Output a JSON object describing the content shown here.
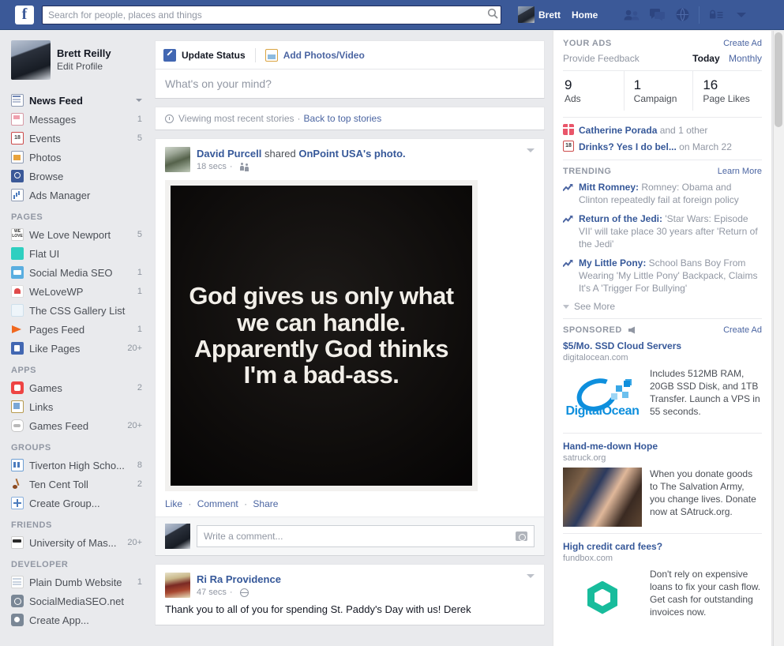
{
  "header": {
    "logo": "f",
    "search_placeholder": "Search for people, places and things",
    "search_value": "",
    "search_icon": "search-icon",
    "profile_name": "Brett",
    "home_label": "Home",
    "icons": [
      "friend-requests-icon",
      "messages-icon",
      "notifications-icon",
      "privacy-shortcuts-icon",
      "account-menu-caret-icon"
    ]
  },
  "sidebar": {
    "profile": {
      "name": "Brett Reilly",
      "sub": "Edit Profile"
    },
    "main_items": [
      {
        "label": "News Feed",
        "count": "",
        "icon": "newsfeed-icon",
        "current": true,
        "caret": true
      },
      {
        "label": "Messages",
        "count": "1",
        "icon": "messages-icon"
      },
      {
        "label": "Events",
        "count": "5",
        "icon": "events-icon"
      },
      {
        "label": "Photos",
        "count": "",
        "icon": "photos-icon"
      },
      {
        "label": "Browse",
        "count": "",
        "icon": "browse-icon"
      },
      {
        "label": "Ads Manager",
        "count": "",
        "icon": "ads-manager-icon"
      }
    ],
    "sections": [
      {
        "title": "PAGES",
        "items": [
          {
            "label": "We Love Newport",
            "count": "5",
            "icon": "page-we-love-newport-icon"
          },
          {
            "label": "Flat UI",
            "count": "",
            "icon": "page-flat-ui-icon"
          },
          {
            "label": "Social Media SEO",
            "count": "1",
            "icon": "page-social-media-seo-icon"
          },
          {
            "label": "WeLoveWP",
            "count": "1",
            "icon": "page-welovewp-icon"
          },
          {
            "label": "The CSS Gallery List",
            "count": "",
            "icon": "page-css-gallery-icon"
          },
          {
            "label": "Pages Feed",
            "count": "1",
            "icon": "pages-feed-icon"
          },
          {
            "label": "Like Pages",
            "count": "20+",
            "icon": "like-pages-icon"
          }
        ]
      },
      {
        "title": "APPS",
        "items": [
          {
            "label": "Games",
            "count": "2",
            "icon": "games-icon"
          },
          {
            "label": "Links",
            "count": "",
            "icon": "links-icon"
          },
          {
            "label": "Games Feed",
            "count": "20+",
            "icon": "games-feed-icon"
          }
        ]
      },
      {
        "title": "GROUPS",
        "items": [
          {
            "label": "Tiverton High Scho...",
            "count": "8",
            "icon": "group-tiverton-icon"
          },
          {
            "label": "Ten Cent Toll",
            "count": "2",
            "icon": "group-ten-cent-toll-icon"
          },
          {
            "label": "Create Group...",
            "count": "",
            "icon": "create-group-icon"
          }
        ]
      },
      {
        "title": "FRIENDS",
        "items": [
          {
            "label": "University of Mas...",
            "count": "20+",
            "icon": "friends-umass-icon"
          }
        ]
      },
      {
        "title": "DEVELOPER",
        "items": [
          {
            "label": "Plain Dumb Website",
            "count": "1",
            "icon": "dev-plain-dumb-icon"
          },
          {
            "label": "SocialMediaSEO.net",
            "count": "",
            "icon": "dev-socialmediaseo-icon"
          },
          {
            "label": "Create App...",
            "count": "",
            "icon": "create-app-icon"
          }
        ]
      }
    ]
  },
  "composer": {
    "tab_status": "Update Status",
    "tab_photos": "Add Photos/Video",
    "placeholder": "What's on your mind?"
  },
  "stories_bar": {
    "text": "Viewing most recent stories",
    "separator": "·",
    "link": "Back to top stories"
  },
  "posts": [
    {
      "author": "David Purcell",
      "action": "shared",
      "target": "OnPoint USA's photo.",
      "time": "18 secs",
      "audience_icon": "friends-audience-icon",
      "photo_text": "God gives us only what we can handle. Apparently God thinks I'm a bad-ass.",
      "actions": {
        "like": "Like",
        "comment": "Comment",
        "share": "Share",
        "sep": "·"
      },
      "comment_placeholder": "Write a comment...",
      "camera_icon": "camera-icon"
    },
    {
      "author": "Ri Ra Providence",
      "time": "47 secs",
      "audience_icon": "public-globe-icon",
      "body": "Thank you to all of you for spending St. Paddy's Day with us! Derek"
    }
  ],
  "right": {
    "your_ads": {
      "title": "YOUR ADS",
      "create_ad": "Create Ad",
      "feedback": "Provide Feedback",
      "today": "Today",
      "monthly": "Monthly",
      "stats": [
        {
          "num": "9",
          "label": "Ads"
        },
        {
          "num": "1",
          "label": "Campaign"
        },
        {
          "num": "16",
          "label": "Page Likes"
        }
      ]
    },
    "notifications": [
      {
        "icon": "gift-icon",
        "name": "Catherine Porada",
        "suffix": " and 1 other"
      },
      {
        "icon": "calendar-icon",
        "icon_text": "18",
        "name": "Drinks? Yes I do bel...",
        "suffix": " on March 22"
      }
    ],
    "trending": {
      "title": "TRENDING",
      "learn_more": "Learn More",
      "items": [
        {
          "topic": "Mitt Romney:",
          "desc": " Romney: Obama and Clinton repeatedly fail at foreign policy"
        },
        {
          "topic": "Return of the Jedi:",
          "desc": " 'Star Wars: Episode VII' will take place 30 years after 'Return of the Jedi'"
        },
        {
          "topic": "My Little Pony:",
          "desc": " School Bans Boy From Wearing 'My Little Pony' Backpack, Claims It's A 'Trigger For Bullying'"
        }
      ],
      "see_more": "See More"
    },
    "sponsored": {
      "title": "SPONSORED",
      "create_ad": "Create Ad",
      "ads": [
        {
          "title": "$5/Mo. SSD Cloud Servers",
          "url": "digitalocean.com",
          "desc": "Includes 512MB RAM, 20GB SSD Disk, and 1TB Transfer. Launch a VPS in 55 seconds.",
          "image": "digitalocean-logo",
          "logo_word": "DigitalOcean"
        },
        {
          "title": "Hand-me-down Hope",
          "url": "satruck.org",
          "desc": "When you donate goods to The Salvation Army, you change lives. Donate now at SAtruck.org.",
          "image": "salvation-army-photo"
        },
        {
          "title": "High credit card fees?",
          "url": "fundbox.com",
          "desc": "Don't rely on expensive loans to fix your cash flow. Get cash for outstanding invoices now.",
          "image": "fundbox-hexagon-logo"
        }
      ]
    }
  }
}
